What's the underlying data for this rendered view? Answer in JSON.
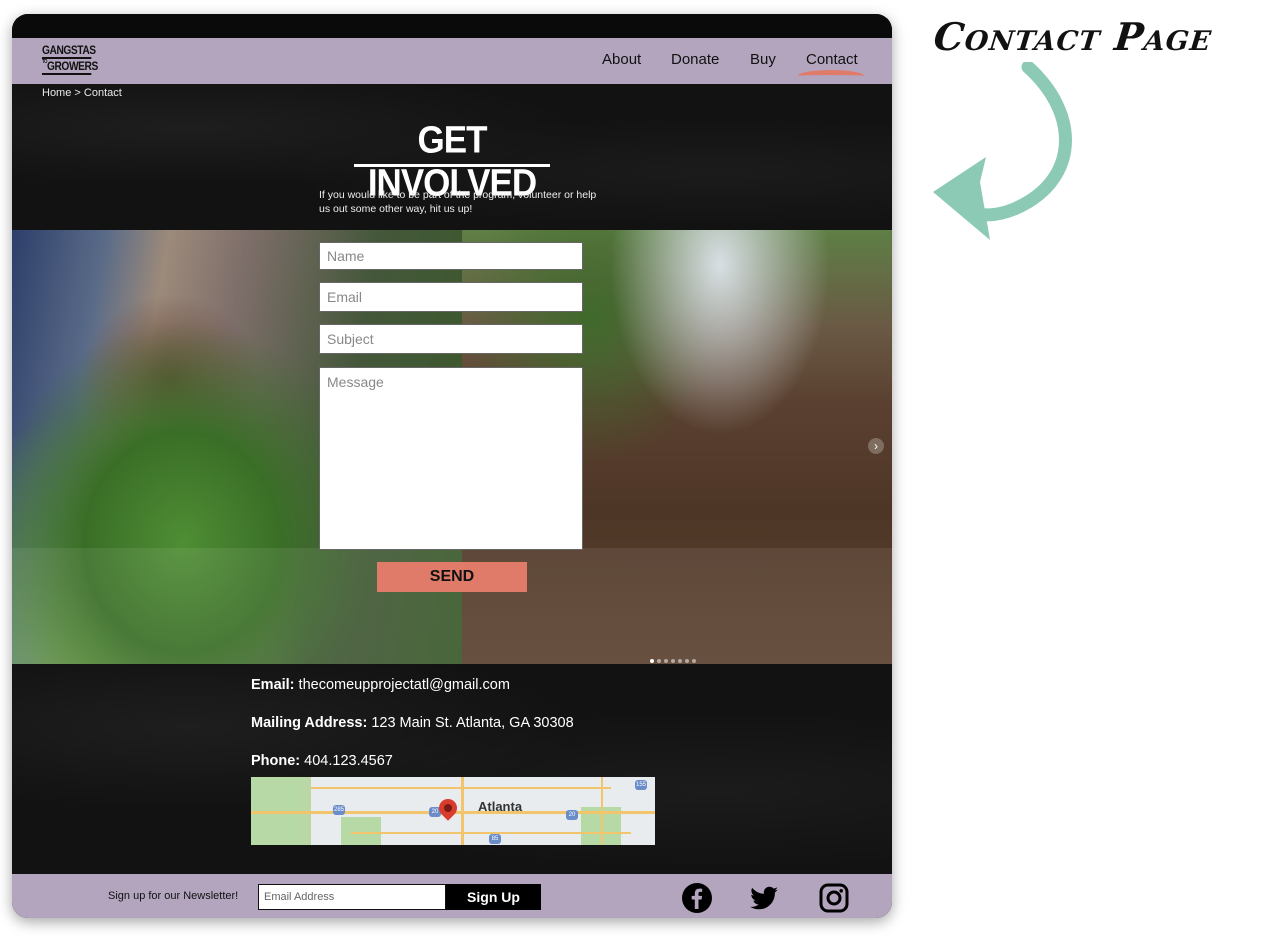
{
  "annotation": {
    "title": "Contact Page"
  },
  "logo": {
    "line1": "GANGSTAS",
    "small": "TO",
    "line2": "GROWERS"
  },
  "nav": {
    "items": [
      {
        "label": "About"
      },
      {
        "label": "Donate"
      },
      {
        "label": "Buy"
      },
      {
        "label": "Contact"
      }
    ],
    "active": "Contact"
  },
  "breadcrumb": {
    "home": "Home",
    "separator": ">",
    "current": "Contact"
  },
  "hero": {
    "title": "GET INVOLVED",
    "text": "If you would like to be part of the program, volunteer or help us out some other way, hit us up!"
  },
  "form": {
    "name_placeholder": "Name",
    "email_placeholder": "Email",
    "subject_placeholder": "Subject",
    "message_placeholder": "Message",
    "send_label": "SEND"
  },
  "slider": {
    "dot_count": 7,
    "active_dot": 1,
    "arrow": "›"
  },
  "contact": {
    "email_label": "Email:",
    "email_value": "thecomeupprojectatl@gmail.com",
    "address_label": "Mailing Address:",
    "address_value": "123 Main St. Atlanta, GA 30308",
    "phone_label": "Phone:",
    "phone_value": "404.123.4567"
  },
  "map": {
    "city_label": "Atlanta",
    "shields": [
      "285",
      "20",
      "20",
      "155",
      "85"
    ]
  },
  "footer": {
    "newsletter_label": "Sign up for our Newsletter!",
    "email_placeholder": "Email Address",
    "signup_label": "Sign Up",
    "social": [
      "facebook-icon",
      "twitter-icon",
      "instagram-icon"
    ]
  },
  "colors": {
    "nav_bg": "#b3a5be",
    "accent": "#e07b6a",
    "annotation_arrow": "#8ccab6",
    "dark_bg": "#121212"
  }
}
